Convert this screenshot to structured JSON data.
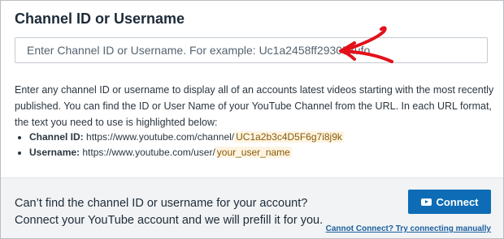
{
  "section": {
    "title": "Channel ID or Username"
  },
  "channel_input": {
    "placeholder": "Enter Channel ID or Username. For example: Uc1a2458ff29305kufo",
    "value": ""
  },
  "description": "Enter any channel ID or username to display all of an accounts latest videos starting with the most recently published. You can find the ID or User Name of your YouTube Channel from the URL. In each URL format, the text you need to use is highlighted below:",
  "examples": [
    {
      "label": "Channel ID:",
      "url_prefix": "https://www.youtube.com/channel/",
      "highlight": "UC1a2b3c4D5F6g7i8j9k"
    },
    {
      "label": "Username:",
      "url_prefix": "https://www.youtube.com/user/",
      "highlight": "your_user_name"
    }
  ],
  "footer": {
    "line1": "Can’t find the channel ID or username for your account?",
    "line2": "Connect your YouTube account and we will prefill it for you.",
    "connect_label": "Connect",
    "manual_link": "Cannot Connect? Try connecting manually"
  },
  "icons": {
    "connect_icon": "youtube-icon",
    "annotation": "red-arrow-icon"
  },
  "colors": {
    "button": "#0d6cb5",
    "highlight_bg": "#fdf4e2",
    "highlight_text": "#8a5a06",
    "annotation": "#e3101b",
    "link": "#1b5e9e"
  }
}
